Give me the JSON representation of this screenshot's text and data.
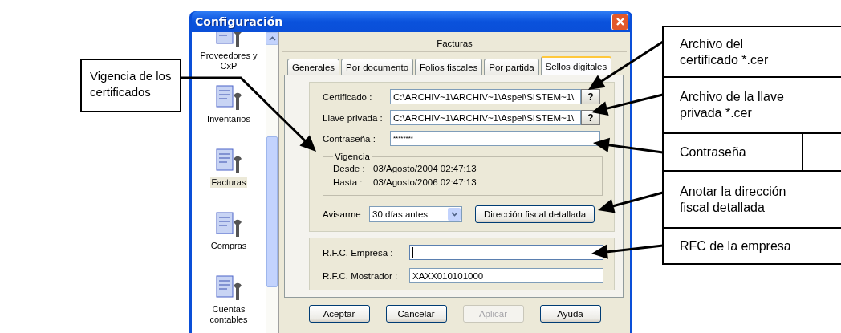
{
  "dialog": {
    "title": "Configuración"
  },
  "sidebar": {
    "items": [
      {
        "label": "Proveedores y CxP",
        "selected": false
      },
      {
        "label": "Inventarios",
        "selected": false
      },
      {
        "label": "Facturas",
        "selected": true
      },
      {
        "label": "Compras",
        "selected": false
      },
      {
        "label": "Cuentas contables",
        "selected": false
      }
    ]
  },
  "panel": {
    "header": "Facturas",
    "tabs": [
      {
        "label": "Generales",
        "selected": false
      },
      {
        "label": "Por documento",
        "selected": false
      },
      {
        "label": "Folios fiscales",
        "selected": false
      },
      {
        "label": "Por partida",
        "selected": false
      },
      {
        "label": "Sellos digitales",
        "selected": true
      }
    ],
    "files": [
      {
        "label": "Certificado :",
        "value": "C:\\ARCHIV~1\\ARCHIV~1\\Aspel\\SISTEM~1\\",
        "button": "?"
      },
      {
        "label": "Llave privada :",
        "value": "C:\\ARCHIV~1\\ARCHIV~1\\Aspel\\SISTEM~1\\",
        "button": "?"
      }
    ],
    "password": {
      "label": "Contraseña :",
      "value": "********"
    },
    "validity": {
      "title": "Vigencia",
      "rows": [
        {
          "label": "Desde :",
          "value": "03/Agosto/2004 02:47:13"
        },
        {
          "label": "Hasta :",
          "value": "03/Agosto/2006 02:47:13"
        }
      ]
    },
    "warn": {
      "label": "Avisarme",
      "value": "30 días antes"
    },
    "address_button": "Dirección fiscal detallada",
    "rfc": [
      {
        "label": "R.F.C. Empresa :",
        "focused": true
      },
      {
        "label": "R.F.C. Mostrador :",
        "value": "XAXX010101000",
        "focused": false
      }
    ],
    "buttons": [
      {
        "label": "Aceptar",
        "disabled": false
      },
      {
        "label": "Cancelar",
        "disabled": false
      },
      {
        "label": "Aplicar",
        "disabled": true
      },
      {
        "label": "Ayuda",
        "disabled": false
      }
    ]
  },
  "callouts": {
    "left": [
      "Vigencia de los certificados"
    ],
    "right": [
      {
        "text": "Archivo del certificado *.cer",
        "split": false
      },
      {
        "text": "Archivo de la llave privada *.cer",
        "split": false
      },
      {
        "text": "Contraseña",
        "split": true
      },
      {
        "text": "Anotar la dirección fiscal detallada",
        "split": false
      },
      {
        "text": "RFC de la empresa",
        "split": false
      }
    ]
  }
}
